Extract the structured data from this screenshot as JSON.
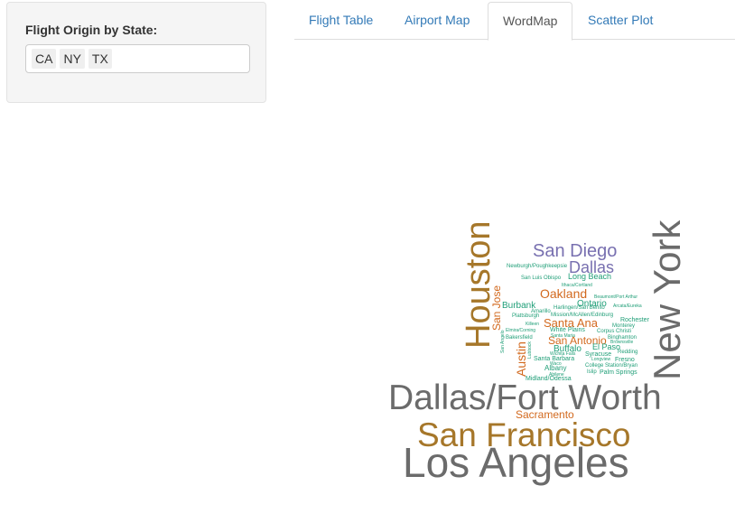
{
  "sidebar": {
    "filter_label": "Flight Origin by State:",
    "selected_states": [
      "CA",
      "NY",
      "TX"
    ]
  },
  "tabs": [
    {
      "label": "Flight Table",
      "active": false
    },
    {
      "label": "Airport Map",
      "active": false
    },
    {
      "label": "WordMap",
      "active": true
    },
    {
      "label": "Scatter Plot",
      "active": false
    }
  ],
  "colors": {
    "link": "#337ab7",
    "gray": "#6b6b6b",
    "brown": "#a6772a",
    "purple": "#7870b0",
    "orange": "#d2691e",
    "teal": "#1f9e77"
  },
  "wordcloud": {
    "words": [
      {
        "text": "Los Angeles",
        "color": "gray"
      },
      {
        "text": "San Francisco",
        "color": "brown"
      },
      {
        "text": "Dallas/Fort Worth",
        "color": "gray"
      },
      {
        "text": "New York",
        "color": "gray"
      },
      {
        "text": "Houston",
        "color": "brown"
      },
      {
        "text": "San Diego",
        "color": "purple"
      },
      {
        "text": "Dallas",
        "color": "purple"
      },
      {
        "text": "Oakland",
        "color": "orange"
      },
      {
        "text": "San Jose",
        "color": "orange"
      },
      {
        "text": "Santa Ana",
        "color": "orange"
      },
      {
        "text": "San Antonio",
        "color": "orange"
      },
      {
        "text": "Austin",
        "color": "orange"
      },
      {
        "text": "Sacramento",
        "color": "orange"
      },
      {
        "text": "Burbank",
        "color": "teal"
      },
      {
        "text": "Ontario",
        "color": "teal"
      },
      {
        "text": "Long Beach",
        "color": "teal"
      },
      {
        "text": "Buffalo",
        "color": "teal"
      },
      {
        "text": "El Paso",
        "color": "teal"
      },
      {
        "text": "Santa Barbara",
        "color": "teal"
      },
      {
        "text": "Albany",
        "color": "teal"
      },
      {
        "text": "Rochester",
        "color": "teal"
      },
      {
        "text": "Newburgh/Poughkeepsie",
        "color": "teal"
      },
      {
        "text": "San Luis Obispo",
        "color": "teal"
      },
      {
        "text": "Ithaca/Cortland",
        "color": "teal"
      },
      {
        "text": "Beaumont/Port Arthur",
        "color": "teal"
      },
      {
        "text": "Arcata/Eureka",
        "color": "teal"
      },
      {
        "text": "Amarillo",
        "color": "teal"
      },
      {
        "text": "Harlingen/San Benito",
        "color": "teal"
      },
      {
        "text": "Plattsburgh",
        "color": "teal"
      },
      {
        "text": "Mission/McAllen/Edinburg",
        "color": "teal"
      },
      {
        "text": "Killeen",
        "color": "teal"
      },
      {
        "text": "Elmira/Corning",
        "color": "teal"
      },
      {
        "text": "White Plains",
        "color": "teal"
      },
      {
        "text": "Santa Maria",
        "color": "teal"
      },
      {
        "text": "Corpus Christi",
        "color": "teal"
      },
      {
        "text": "Monterey",
        "color": "teal"
      },
      {
        "text": "Binghamton",
        "color": "teal"
      },
      {
        "text": "Bakersfield",
        "color": "teal"
      },
      {
        "text": "Brownsville",
        "color": "teal"
      },
      {
        "text": "Wichita Falls",
        "color": "teal"
      },
      {
        "text": "Syracuse",
        "color": "teal"
      },
      {
        "text": "Redding",
        "color": "teal"
      },
      {
        "text": "Lubbock",
        "color": "teal"
      },
      {
        "text": "Longview",
        "color": "teal"
      },
      {
        "text": "Fresno",
        "color": "teal"
      },
      {
        "text": "Waco",
        "color": "teal"
      },
      {
        "text": "College Station/Bryan",
        "color": "teal"
      },
      {
        "text": "Abilene",
        "color": "teal"
      },
      {
        "text": "Islip",
        "color": "teal"
      },
      {
        "text": "Palm Springs",
        "color": "teal"
      },
      {
        "text": "Midland/Odessa",
        "color": "teal"
      },
      {
        "text": "San Angelo",
        "color": "teal"
      }
    ]
  }
}
